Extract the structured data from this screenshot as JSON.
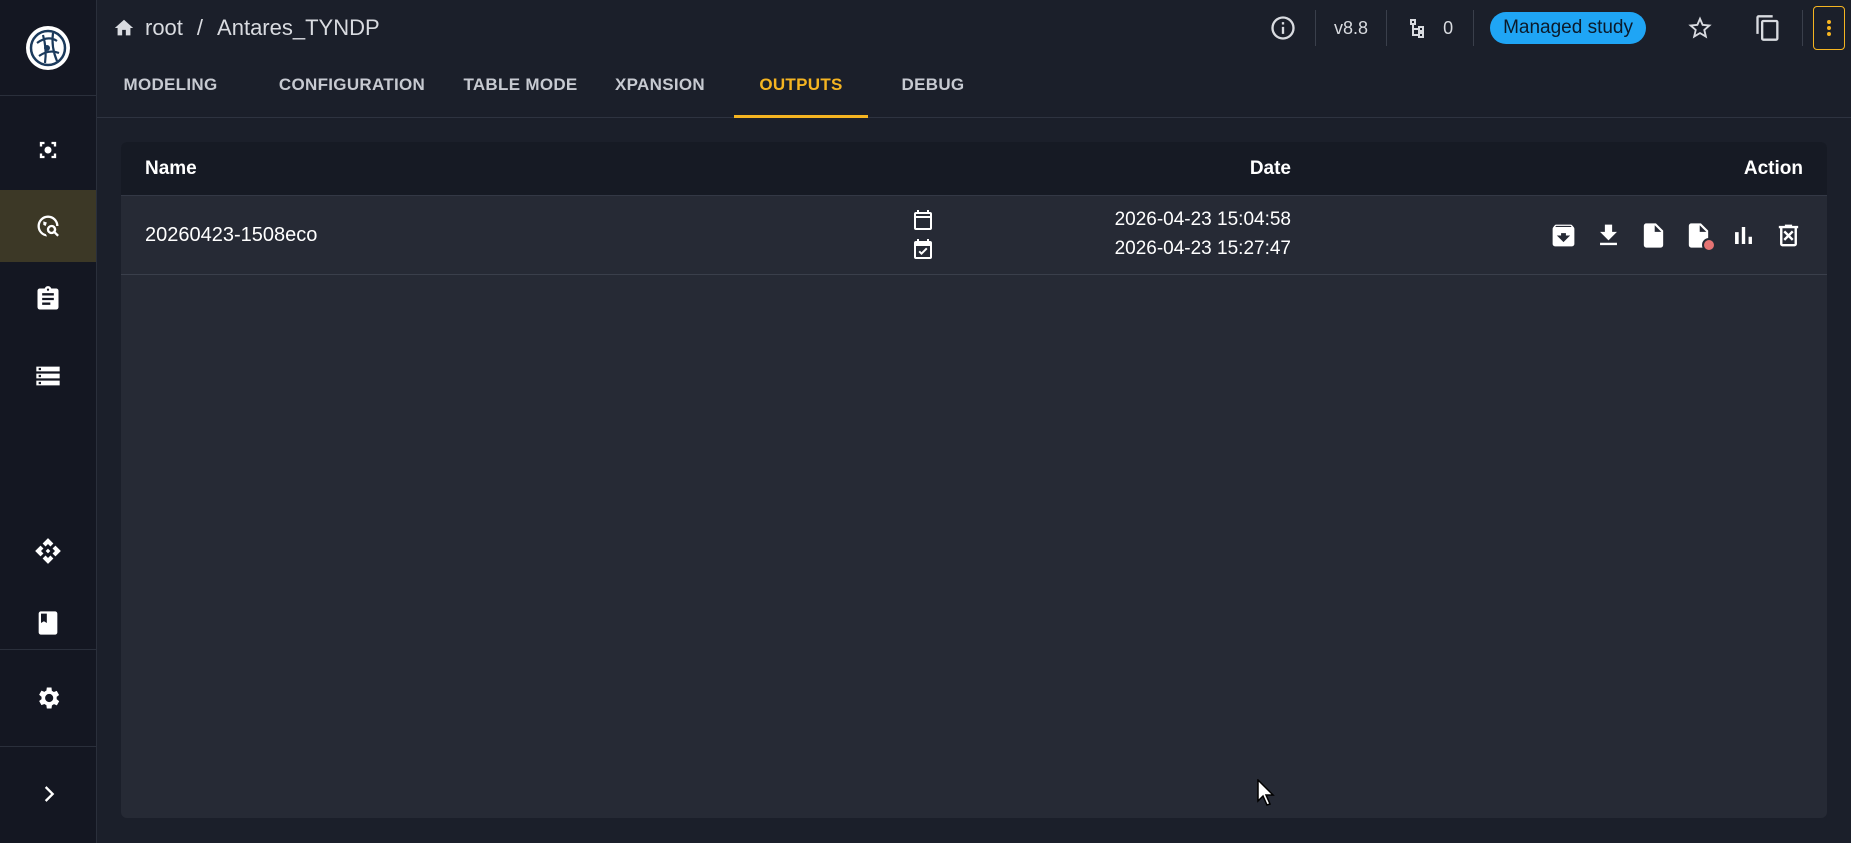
{
  "breadcrumb": {
    "root": "root",
    "separator": "/",
    "study": "Antares_TYNDP"
  },
  "header": {
    "version": "v8.8",
    "variant_count": "0",
    "badge": "Managed study"
  },
  "tabs": [
    {
      "label": "MODELING"
    },
    {
      "label": "CONFIGURATION"
    },
    {
      "label": "TABLE MODE"
    },
    {
      "label": "XPANSION"
    },
    {
      "label": "OUTPUTS",
      "active": true
    },
    {
      "label": "DEBUG"
    }
  ],
  "table": {
    "headers": {
      "name": "Name",
      "date": "Date",
      "action": "Action"
    },
    "rows": [
      {
        "name": "20260423-1508eco",
        "created": "2026-04-23 15:04:58",
        "completed": "2026-04-23 15:27:47"
      }
    ]
  },
  "colors": {
    "accent": "#f5b421",
    "badge": "#1fa5f5",
    "error": "#e57373",
    "background": "#1b1f2a"
  },
  "icons": [
    "logo-icon",
    "explore-icon",
    "study-search-icon",
    "clipboard-icon",
    "storage-icon",
    "api-icon",
    "bookmark-icon",
    "gear-icon",
    "chevron-right-icon",
    "home-icon",
    "info-icon",
    "variants-icon",
    "star-icon",
    "copy-icon",
    "more-vert-icon",
    "calendar-icon",
    "calendar-check-icon",
    "archive-icon",
    "download-icon",
    "file-icon",
    "file-error-icon",
    "bar-chart-icon",
    "delete-icon"
  ]
}
